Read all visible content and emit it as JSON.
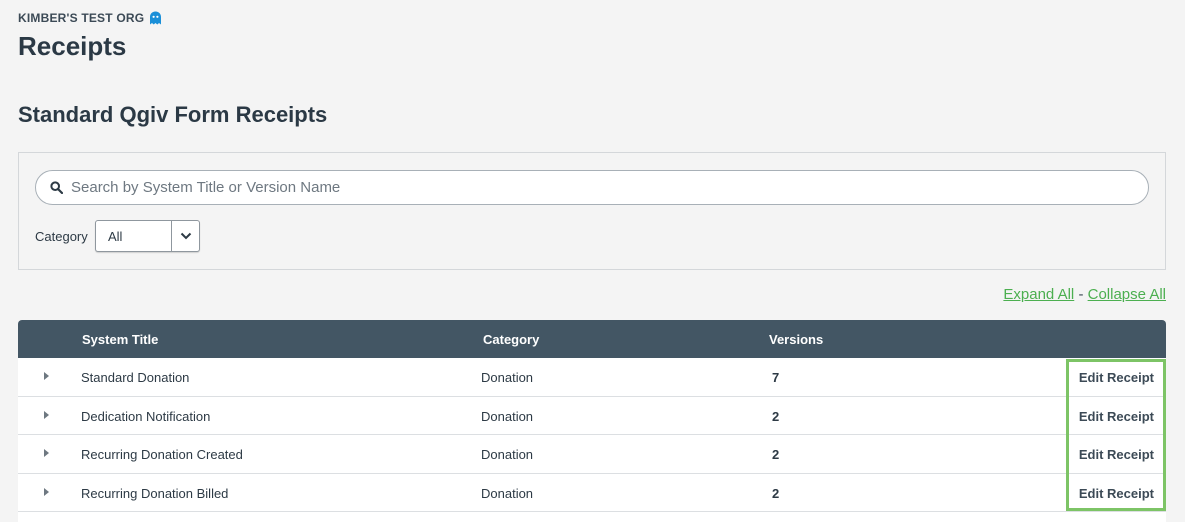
{
  "org": {
    "name": "KIMBER'S TEST ORG",
    "icon": "ghost-icon",
    "icon_color": "#1a8fd8"
  },
  "page": {
    "title": "Receipts"
  },
  "section": {
    "title": "Standard Qgiv Form Receipts"
  },
  "filters": {
    "search_placeholder": "Search by System Title or Version Name",
    "search_value": "",
    "category_label": "Category",
    "category_selected": "All"
  },
  "links": {
    "expand_all": "Expand All",
    "separator": "-",
    "collapse_all": "Collapse All",
    "color": "#4caf50"
  },
  "table": {
    "headers": {
      "system_title": "System Title",
      "category": "Category",
      "versions": "Versions"
    },
    "rows": [
      {
        "system_title": "Standard Donation",
        "category": "Donation",
        "versions": "7",
        "action": "Edit Receipt"
      },
      {
        "system_title": "Dedication Notification",
        "category": "Donation",
        "versions": "2",
        "action": "Edit Receipt"
      },
      {
        "system_title": "Recurring Donation Created",
        "category": "Donation",
        "versions": "2",
        "action": "Edit Receipt"
      },
      {
        "system_title": "Recurring Donation Billed",
        "category": "Donation",
        "versions": "2",
        "action": "Edit Receipt"
      }
    ],
    "header_color": "#435664",
    "highlight_color": "#7dc466"
  }
}
